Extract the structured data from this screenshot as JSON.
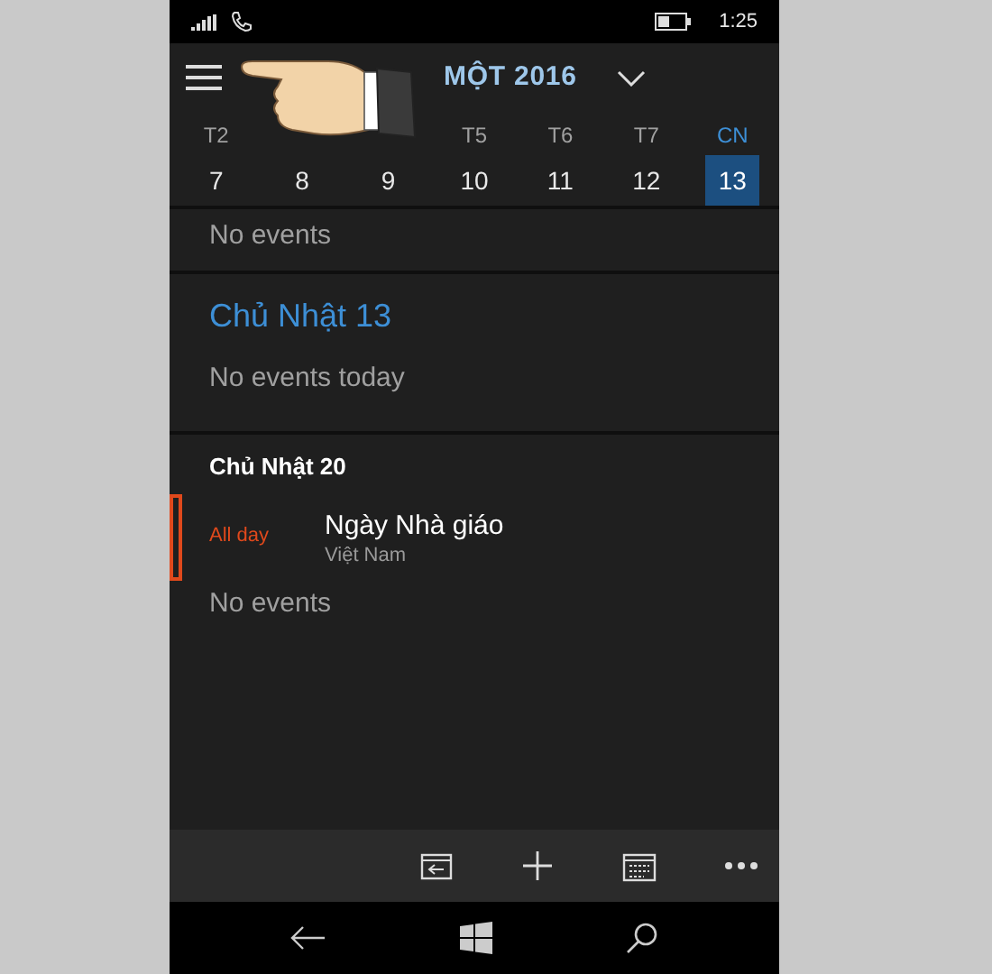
{
  "status_bar": {
    "time": "1:25"
  },
  "header": {
    "title": "MỘT 2016"
  },
  "week": [
    {
      "day": "T2",
      "date": "7",
      "selected": false
    },
    {
      "date": "8",
      "selected": false
    },
    {
      "date": "9",
      "selected": false
    },
    {
      "day": "T5",
      "date": "10",
      "selected": false
    },
    {
      "day": "T6",
      "date": "11",
      "selected": false
    },
    {
      "day": "T7",
      "date": "12",
      "selected": false
    },
    {
      "day": "CN",
      "date": "13",
      "selected": true
    }
  ],
  "sections": [
    {
      "kind": "empty",
      "text": "No events"
    },
    {
      "kind": "today",
      "heading": "Chủ Nhật 13",
      "text": "No events today"
    },
    {
      "kind": "day",
      "heading": "Chủ Nhật 20",
      "events": [
        {
          "time": "All day",
          "title": "Ngày Nhà giáo",
          "subtitle": "Việt Nam",
          "color": "#e0491c"
        }
      ],
      "text": "No events"
    }
  ]
}
